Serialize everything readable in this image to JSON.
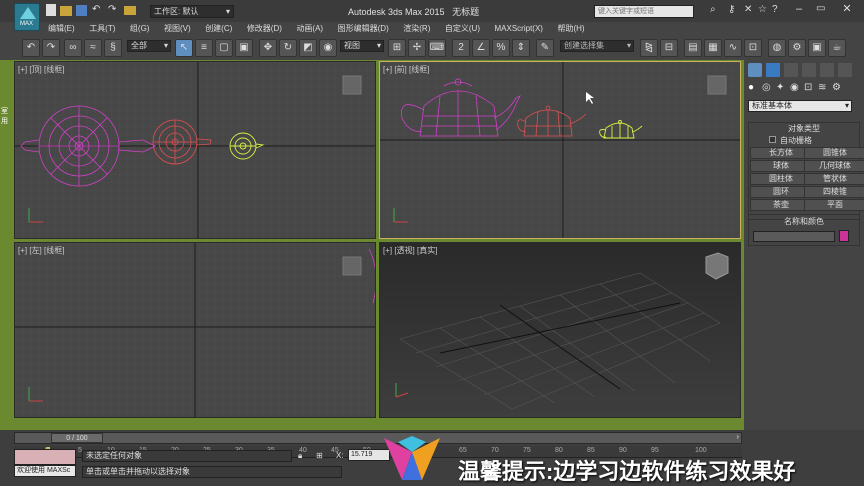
{
  "title": {
    "app": "Autodesk 3ds Max  2015",
    "doc": "无标题",
    "workspace": "工作区: 默认",
    "search_placeholder": "键入关键字或短语"
  },
  "menu": [
    "编辑(E)",
    "工具(T)",
    "组(G)",
    "视图(V)",
    "创建(C)",
    "修改器(D)",
    "动画(A)",
    "图形编辑器(D)",
    "渲染(R)",
    "自定义(U)",
    "MAXScript(X)",
    "帮助(H)"
  ],
  "toolbar": {
    "filter_select": "全部",
    "ref_coord": "视图",
    "selection_set": "创建选择集"
  },
  "viewports": {
    "top": "[+] [顶] [线框]",
    "front": "[+] [前] [线框]",
    "left": "[+] [左] [线框]",
    "persp": "[+] [透视] [真实]"
  },
  "command_panel": {
    "dropdown": "标准基本体",
    "rollout_object_type": "对象类型",
    "autogrid": "自动栅格",
    "buttons": [
      "长方体",
      "圆锥体",
      "球体",
      "几何球体",
      "圆柱体",
      "管状体",
      "圆环",
      "四棱锥",
      "茶壶",
      "平面"
    ],
    "rollout_name_color": "名称和颜色",
    "object_color": "#cc3399"
  },
  "timeline": {
    "frame_counter": "0 / 100",
    "ticks": [
      "0",
      "5",
      "10",
      "15",
      "20",
      "25",
      "30",
      "35",
      "40",
      "45",
      "50",
      "55",
      "60",
      "65",
      "70",
      "75",
      "80",
      "85",
      "90",
      "95",
      "100"
    ]
  },
  "status": {
    "welcome": "欢迎使用  MAXSc",
    "selection": "未选定任何对象",
    "prompt": "单击或单击并拖动以选择对象",
    "x_label": "X:",
    "x_value": "15.719"
  },
  "overlay": {
    "tip": "温馨提示:边学习边软件练习效果好"
  },
  "colors": {
    "teapot_large": "#d040c8",
    "teapot_medium": "#e05050",
    "teapot_small": "#d8f040",
    "active_border": "#c8b060"
  }
}
